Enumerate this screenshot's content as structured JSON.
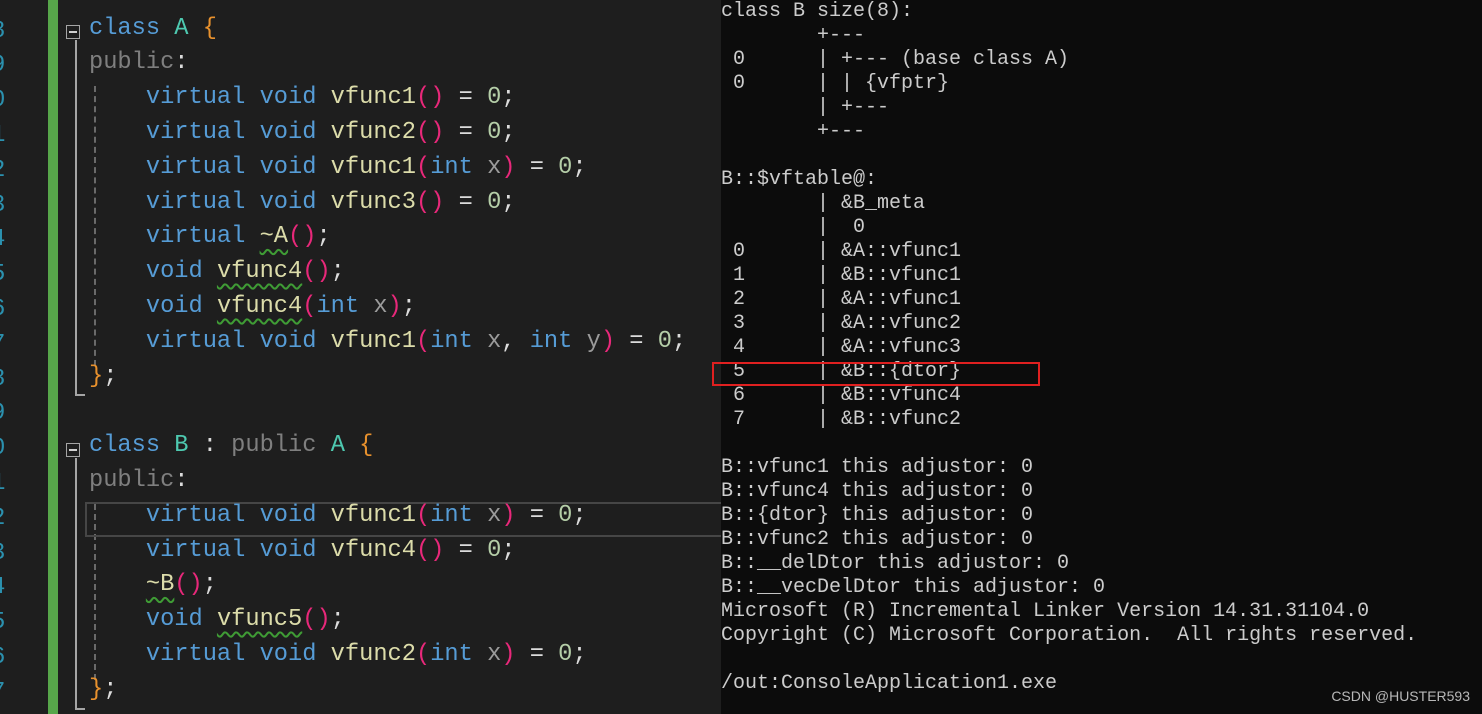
{
  "editor": {
    "line_numbers": [
      "8",
      "9",
      "0",
      "1",
      "2",
      "3",
      "4",
      "5",
      "6",
      "7",
      "8",
      "9",
      "0",
      "1",
      "2",
      "3",
      "4",
      "5",
      "6",
      "7"
    ],
    "lines": [
      [
        [
          "class",
          "kw"
        ],
        [
          " ",
          ""
        ],
        [
          "A",
          "cls"
        ],
        [
          " ",
          ""
        ],
        [
          "{",
          "br"
        ]
      ],
      [
        [
          "public",
          "pub"
        ],
        [
          ":",
          "op"
        ]
      ],
      [
        [
          "    ",
          ""
        ],
        [
          "virtual",
          "kw"
        ],
        [
          " ",
          ""
        ],
        [
          "void",
          "kw"
        ],
        [
          " ",
          ""
        ],
        [
          "vfunc1",
          "fn"
        ],
        [
          "()",
          "pa"
        ],
        [
          " = ",
          "op"
        ],
        [
          "0",
          "num"
        ],
        [
          ";",
          "op"
        ]
      ],
      [
        [
          "    ",
          ""
        ],
        [
          "virtual",
          "kw"
        ],
        [
          " ",
          ""
        ],
        [
          "void",
          "kw"
        ],
        [
          " ",
          ""
        ],
        [
          "vfunc2",
          "fn"
        ],
        [
          "()",
          "pa"
        ],
        [
          " = ",
          "op"
        ],
        [
          "0",
          "num"
        ],
        [
          ";",
          "op"
        ]
      ],
      [
        [
          "    ",
          ""
        ],
        [
          "virtual",
          "kw"
        ],
        [
          " ",
          ""
        ],
        [
          "void",
          "kw"
        ],
        [
          " ",
          ""
        ],
        [
          "vfunc1",
          "fn"
        ],
        [
          "(",
          "pa"
        ],
        [
          "int",
          "kw"
        ],
        [
          " ",
          ""
        ],
        [
          "x",
          "pr"
        ],
        [
          ")",
          "pa"
        ],
        [
          " = ",
          "op"
        ],
        [
          "0",
          "num"
        ],
        [
          ";",
          "op"
        ]
      ],
      [
        [
          "    ",
          ""
        ],
        [
          "virtual",
          "kw"
        ],
        [
          " ",
          ""
        ],
        [
          "void",
          "kw"
        ],
        [
          " ",
          ""
        ],
        [
          "vfunc3",
          "fn"
        ],
        [
          "()",
          "pa"
        ],
        [
          " = ",
          "op"
        ],
        [
          "0",
          "num"
        ],
        [
          ";",
          "op"
        ]
      ],
      [
        [
          "    ",
          ""
        ],
        [
          "virtual",
          "kw"
        ],
        [
          " ",
          ""
        ],
        [
          "~A",
          "fn sq"
        ],
        [
          "()",
          "pa"
        ],
        [
          ";",
          "op"
        ]
      ],
      [
        [
          "    ",
          ""
        ],
        [
          "void",
          "kw"
        ],
        [
          " ",
          ""
        ],
        [
          "vfunc4",
          "fn sq"
        ],
        [
          "()",
          "pa"
        ],
        [
          ";",
          "op"
        ]
      ],
      [
        [
          "    ",
          ""
        ],
        [
          "void",
          "kw"
        ],
        [
          " ",
          ""
        ],
        [
          "vfunc4",
          "fn sq"
        ],
        [
          "(",
          "pa"
        ],
        [
          "int",
          "kw"
        ],
        [
          " ",
          ""
        ],
        [
          "x",
          "pr"
        ],
        [
          ")",
          "pa"
        ],
        [
          ";",
          "op"
        ]
      ],
      [
        [
          "    ",
          ""
        ],
        [
          "virtual",
          "kw"
        ],
        [
          " ",
          ""
        ],
        [
          "void",
          "kw"
        ],
        [
          " ",
          ""
        ],
        [
          "vfunc1",
          "fn"
        ],
        [
          "(",
          "pa"
        ],
        [
          "int",
          "kw"
        ],
        [
          " ",
          ""
        ],
        [
          "x",
          "pr"
        ],
        [
          ", ",
          "op"
        ],
        [
          "int",
          "kw"
        ],
        [
          " ",
          ""
        ],
        [
          "y",
          "pr"
        ],
        [
          ")",
          "pa"
        ],
        [
          " = ",
          "op"
        ],
        [
          "0",
          "num"
        ],
        [
          ";",
          "op"
        ]
      ],
      [
        [
          "}",
          "br"
        ],
        [
          ";",
          "op"
        ]
      ],
      [],
      [
        [
          "class",
          "kw"
        ],
        [
          " ",
          ""
        ],
        [
          "B",
          "cls"
        ],
        [
          " : ",
          "op"
        ],
        [
          "public",
          "pub"
        ],
        [
          " ",
          ""
        ],
        [
          "A",
          "cls"
        ],
        [
          " ",
          ""
        ],
        [
          "{",
          "br"
        ]
      ],
      [
        [
          "public",
          "pub"
        ],
        [
          ":",
          "op"
        ]
      ],
      [
        [
          "    ",
          ""
        ],
        [
          "virtual",
          "kw"
        ],
        [
          " ",
          ""
        ],
        [
          "void",
          "kw"
        ],
        [
          " ",
          ""
        ],
        [
          "vfunc1",
          "fn"
        ],
        [
          "(",
          "pa"
        ],
        [
          "int",
          "kw"
        ],
        [
          " ",
          ""
        ],
        [
          "x",
          "pr"
        ],
        [
          ")",
          "pa"
        ],
        [
          " = ",
          "op"
        ],
        [
          "0",
          "num"
        ],
        [
          ";",
          "op"
        ]
      ],
      [
        [
          "    ",
          ""
        ],
        [
          "virtual",
          "kw"
        ],
        [
          " ",
          ""
        ],
        [
          "void",
          "kw"
        ],
        [
          " ",
          ""
        ],
        [
          "vfunc4",
          "fn"
        ],
        [
          "()",
          "pa"
        ],
        [
          " = ",
          "op"
        ],
        [
          "0",
          "num"
        ],
        [
          ";",
          "op"
        ]
      ],
      [
        [
          "    ",
          ""
        ],
        [
          "~B",
          "fn sq"
        ],
        [
          "()",
          "pa"
        ],
        [
          ";",
          "op"
        ]
      ],
      [
        [
          "    ",
          ""
        ],
        [
          "void",
          "kw"
        ],
        [
          " ",
          ""
        ],
        [
          "vfunc5",
          "fn sq"
        ],
        [
          "()",
          "pa"
        ],
        [
          ";",
          "op"
        ]
      ],
      [
        [
          "    ",
          ""
        ],
        [
          "virtual",
          "kw"
        ],
        [
          " ",
          ""
        ],
        [
          "void",
          "kw"
        ],
        [
          " ",
          ""
        ],
        [
          "vfunc2",
          "fn"
        ],
        [
          "(",
          "pa"
        ],
        [
          "int",
          "kw"
        ],
        [
          " ",
          ""
        ],
        [
          "x",
          "pr"
        ],
        [
          ")",
          "pa"
        ],
        [
          " = ",
          "op"
        ],
        [
          "0",
          "num"
        ],
        [
          ";",
          "op"
        ]
      ],
      [
        [
          "}",
          "br"
        ],
        [
          ";",
          "op"
        ]
      ]
    ]
  },
  "console": {
    "lines": [
      "class B size(8):",
      "        +---",
      " 0      | +--- (base class A)",
      " 0      | | {vfptr}",
      "        | +---",
      "        +---",
      "",
      "B::$vftable@:",
      "        | &B_meta",
      "        |  0",
      " 0      | &A::vfunc1",
      " 1      | &B::vfunc1",
      " 2      | &A::vfunc1",
      " 3      | &A::vfunc2",
      " 4      | &A::vfunc3",
      " 5      | &B::{dtor}",
      " 6      | &B::vfunc4",
      " 7      | &B::vfunc2",
      "",
      "B::vfunc1 this adjustor: 0",
      "B::vfunc4 this adjustor: 0",
      "B::{dtor} this adjustor: 0",
      "B::vfunc2 this adjustor: 0",
      "B::__delDtor this adjustor: 0",
      "B::__vecDelDtor this adjustor: 0",
      "Microsoft (R) Incremental Linker Version 14.31.31104.0",
      "Copyright (C) Microsoft Corporation.  All rights reserved.",
      "",
      "/out:ConsoleApplication1.exe"
    ],
    "highlighted_line": " 5      | &B::{dtor}",
    "highlight_color": "#e02020"
  },
  "watermark": "CSDN @HUSTER593"
}
